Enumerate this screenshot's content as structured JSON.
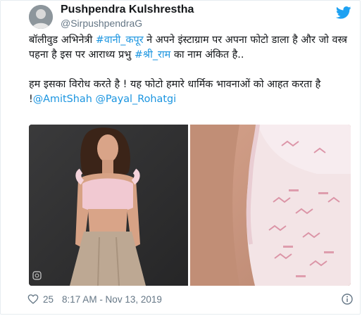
{
  "tweet": {
    "author_name": "Pushpendra Kulshrestha",
    "author_handle": "@SirpushpendraG",
    "text": {
      "p1_part1": "बॉलीवुड अभिनेत्री ",
      "p1_hashtag1": "#वानी_कपूर",
      "p1_part2": " ने अपने इंस्टाग्राम पर अपना फोटो डाला है और जो वस्त्र पहना है इस पर आराध्य प्रभु ",
      "p1_hashtag2": "#श्री_राम",
      "p1_part3": " का नाम अंकित है..",
      "p2_part1": "हम इसका विरोध करते है ! यह फोटो हमारे धार्मिक भावनाओं को आहत करता है !",
      "p2_mention1": "@AmitShah",
      "p2_space": " ",
      "p2_mention2": "@Payal_Rohatgi"
    },
    "likes": "25",
    "timestamp": "8:17 AM - Nov 13, 2019"
  },
  "icons": {
    "bird": "twitter-bird-icon",
    "heart": "heart-icon",
    "info": "info-icon"
  },
  "colors": {
    "link": "#1b95e0",
    "brand": "#1da1f2",
    "secondary_text": "#657786",
    "primary_text": "#14171a"
  }
}
